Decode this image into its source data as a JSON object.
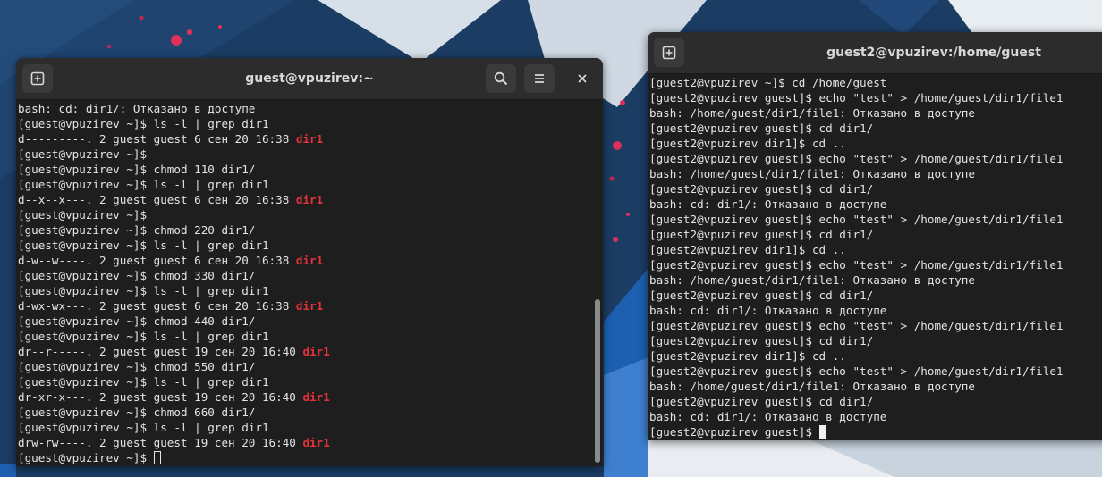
{
  "window_left": {
    "title": "guest@vpuzirev:~",
    "lines": [
      [
        {
          "t": "bash: cd: dir1/: Отказано в доступе"
        }
      ],
      [
        {
          "t": "[guest@vpuzirev ~]$ ls -l | grep dir1"
        }
      ],
      [
        {
          "t": "d---------. 2 guest guest 6 сен 20 16:38 "
        },
        {
          "t": "dir1",
          "hl": true
        }
      ],
      [
        {
          "t": "[guest@vpuzirev ~]$"
        }
      ],
      [
        {
          "t": "[guest@vpuzirev ~]$ chmod 110 dir1/"
        }
      ],
      [
        {
          "t": "[guest@vpuzirev ~]$ ls -l | grep dir1"
        }
      ],
      [
        {
          "t": "d--x--x---. 2 guest guest 6 сен 20 16:38 "
        },
        {
          "t": "dir1",
          "hl": true
        }
      ],
      [
        {
          "t": "[guest@vpuzirev ~]$"
        }
      ],
      [
        {
          "t": "[guest@vpuzirev ~]$ chmod 220 dir1/"
        }
      ],
      [
        {
          "t": "[guest@vpuzirev ~]$ ls -l | grep dir1"
        }
      ],
      [
        {
          "t": "d-w--w----. 2 guest guest 6 сен 20 16:38 "
        },
        {
          "t": "dir1",
          "hl": true
        }
      ],
      [
        {
          "t": "[guest@vpuzirev ~]$ chmod 330 dir1/"
        }
      ],
      [
        {
          "t": "[guest@vpuzirev ~]$ ls -l | grep dir1"
        }
      ],
      [
        {
          "t": "d-wx-wx---. 2 guest guest 6 сен 20 16:38 "
        },
        {
          "t": "dir1",
          "hl": true
        }
      ],
      [
        {
          "t": "[guest@vpuzirev ~]$ chmod 440 dir1/"
        }
      ],
      [
        {
          "t": "[guest@vpuzirev ~]$ ls -l | grep dir1"
        }
      ],
      [
        {
          "t": "dr--r-----. 2 guest guest 19 сен 20 16:40 "
        },
        {
          "t": "dir1",
          "hl": true
        }
      ],
      [
        {
          "t": "[guest@vpuzirev ~]$ chmod 550 dir1/"
        }
      ],
      [
        {
          "t": "[guest@vpuzirev ~]$ ls -l | grep dir1"
        }
      ],
      [
        {
          "t": "dr-xr-x---. 2 guest guest 19 сен 20 16:40 "
        },
        {
          "t": "dir1",
          "hl": true
        }
      ],
      [
        {
          "t": "[guest@vpuzirev ~]$ chmod 660 dir1/"
        }
      ],
      [
        {
          "t": "[guest@vpuzirev ~]$ ls -l | grep dir1"
        }
      ],
      [
        {
          "t": "drw-rw----. 2 guest guest 19 сен 20 16:40 "
        },
        {
          "t": "dir1",
          "hl": true
        }
      ],
      [
        {
          "t": "[guest@vpuzirev ~]$ "
        },
        {
          "cursor": "outline"
        }
      ]
    ]
  },
  "window_right": {
    "title": "guest2@vpuzirev:/home/guest",
    "lines": [
      [
        {
          "t": "[guest2@vpuzirev ~]$ cd /home/guest"
        }
      ],
      [
        {
          "t": "[guest2@vpuzirev guest]$ echo \"test\" > /home/guest/dir1/file1"
        }
      ],
      [
        {
          "t": "bash: /home/guest/dir1/file1: Отказано в доступе"
        }
      ],
      [
        {
          "t": "[guest2@vpuzirev guest]$ cd dir1/"
        }
      ],
      [
        {
          "t": "[guest2@vpuzirev dir1]$ cd .."
        }
      ],
      [
        {
          "t": "[guest2@vpuzirev guest]$ echo \"test\" > /home/guest/dir1/file1"
        }
      ],
      [
        {
          "t": "bash: /home/guest/dir1/file1: Отказано в доступе"
        }
      ],
      [
        {
          "t": "[guest2@vpuzirev guest]$ cd dir1/"
        }
      ],
      [
        {
          "t": "bash: cd: dir1/: Отказано в доступе"
        }
      ],
      [
        {
          "t": "[guest2@vpuzirev guest]$ echo \"test\" > /home/guest/dir1/file1"
        }
      ],
      [
        {
          "t": "[guest2@vpuzirev guest]$ cd dir1/"
        }
      ],
      [
        {
          "t": "[guest2@vpuzirev dir1]$ cd .."
        }
      ],
      [
        {
          "t": "[guest2@vpuzirev guest]$ echo \"test\" > /home/guest/dir1/file1"
        }
      ],
      [
        {
          "t": "bash: /home/guest/dir1/file1: Отказано в доступе"
        }
      ],
      [
        {
          "t": "[guest2@vpuzirev guest]$ cd dir1/"
        }
      ],
      [
        {
          "t": "bash: cd: dir1/: Отказано в доступе"
        }
      ],
      [
        {
          "t": "[guest2@vpuzirev guest]$ echo \"test\" > /home/guest/dir1/file1"
        }
      ],
      [
        {
          "t": "[guest2@vpuzirev guest]$ cd dir1/"
        }
      ],
      [
        {
          "t": "[guest2@vpuzirev dir1]$ cd .."
        }
      ],
      [
        {
          "t": "[guest2@vpuzirev guest]$ echo \"test\" > /home/guest/dir1/file1"
        }
      ],
      [
        {
          "t": "bash: /home/guest/dir1/file1: Отказано в доступе"
        }
      ],
      [
        {
          "t": "[guest2@vpuzirev guest]$ cd dir1/"
        }
      ],
      [
        {
          "t": "bash: cd: dir1/: Отказано в доступе"
        }
      ],
      [
        {
          "t": "[guest2@vpuzirev guest]$ "
        },
        {
          "cursor": "solid"
        }
      ]
    ]
  },
  "icons": {
    "new_tab": "new-tab-icon",
    "search": "search-icon",
    "menu": "hamburger-menu-icon",
    "close": "close-icon"
  },
  "colors": {
    "terminal_bg": "#1e1e1e",
    "titlebar_bg": "#2c2c2c",
    "text": "#e4e4e4",
    "highlight": "#e0333a",
    "desktop_bg": "#1b3c63"
  }
}
